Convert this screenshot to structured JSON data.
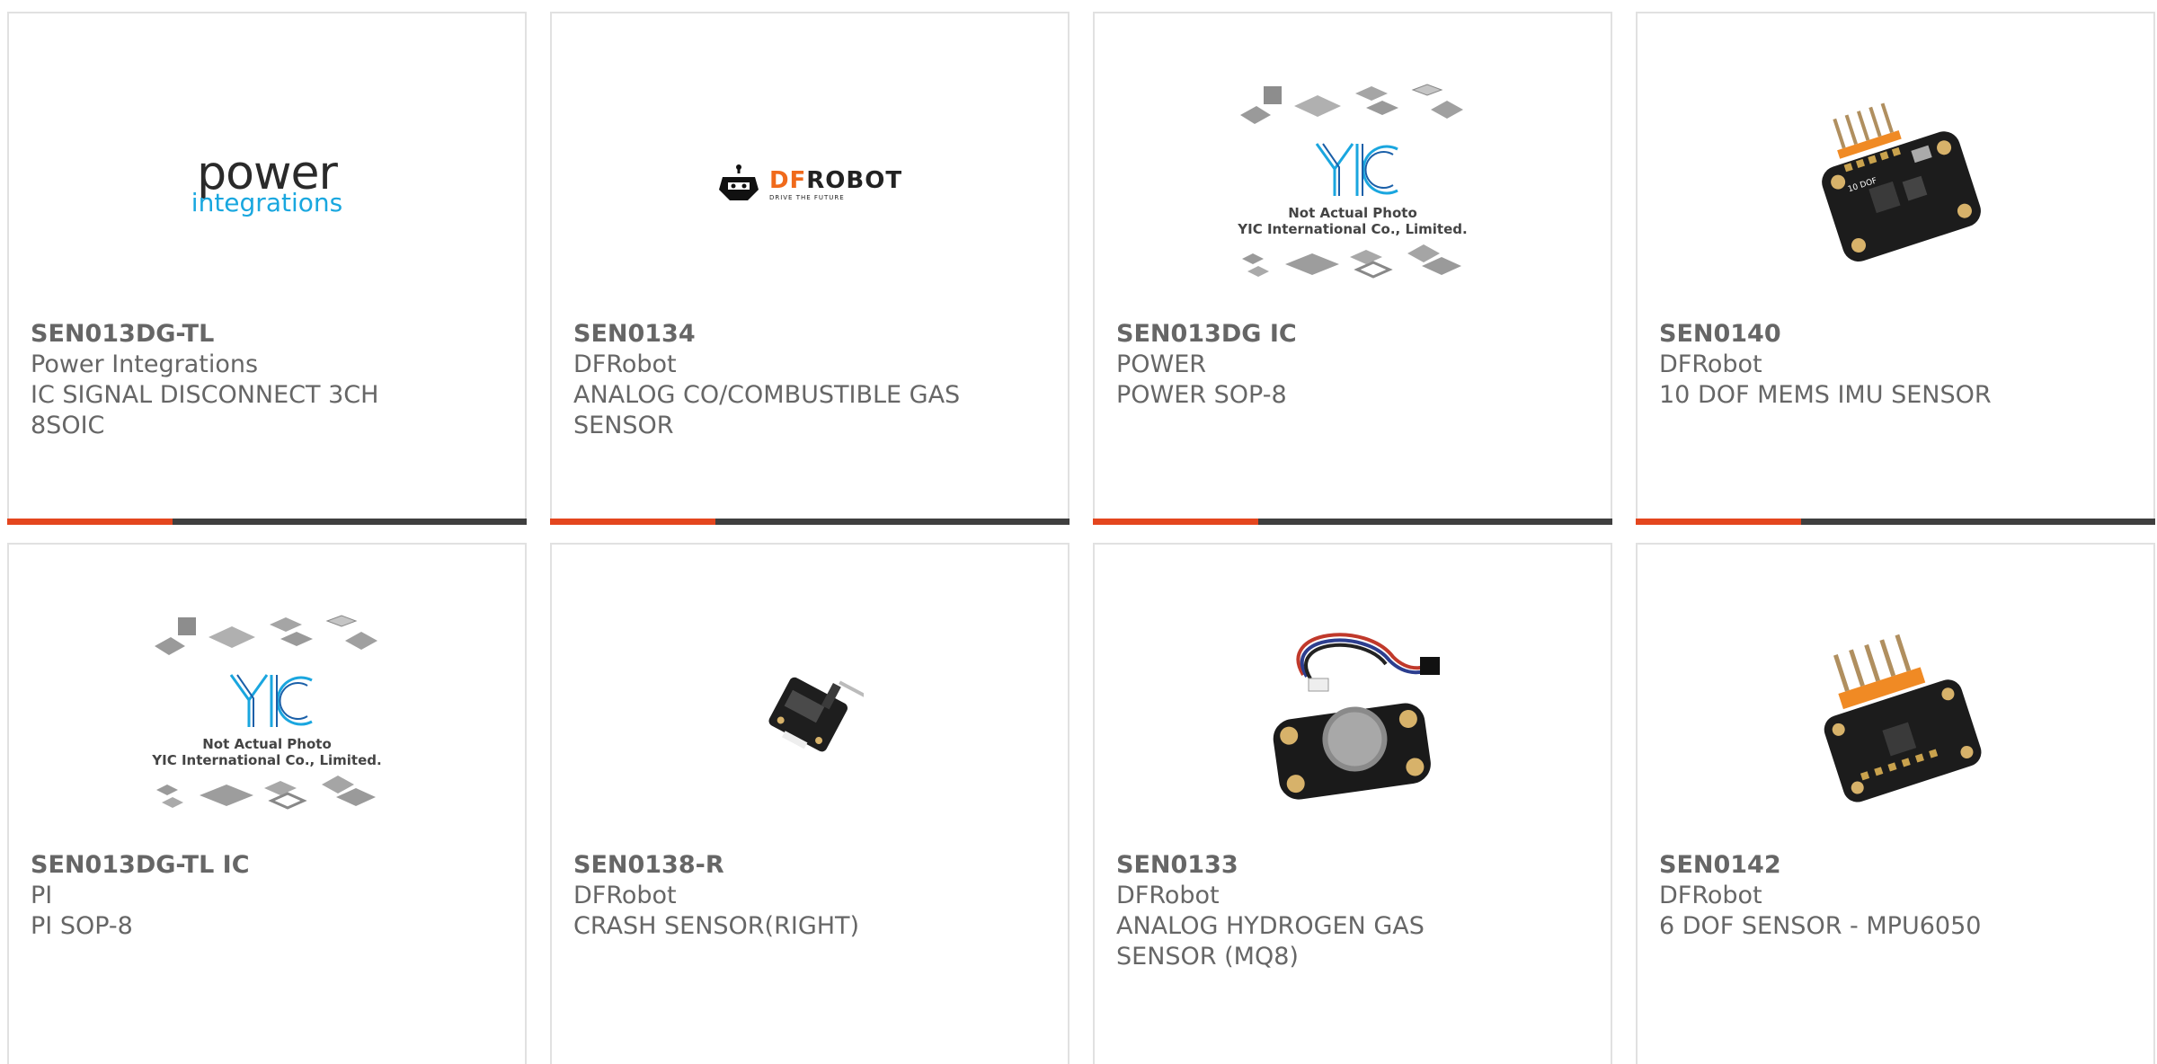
{
  "products": [
    {
      "part": "SEN013DG-TL",
      "manufacturer": "Power Integrations",
      "description": "IC SIGNAL DISCONNECT 3CH\n8SOIC",
      "image": "power-integrations-logo"
    },
    {
      "part": "SEN0134",
      "manufacturer": "DFRobot",
      "description": "ANALOG CO/COMBUSTIBLE GAS\nSENSOR",
      "image": "dfrobot-logo"
    },
    {
      "part": "SEN013DG IC",
      "manufacturer": "POWER",
      "description": "POWER SOP-8",
      "image": "yic-placeholder"
    },
    {
      "part": "SEN0140",
      "manufacturer": "DFRobot",
      "description": "10 DOF MEMS IMU SENSOR",
      "image": "imu-board-photo"
    },
    {
      "part": "SEN013DG-TL IC",
      "manufacturer": "PI",
      "description": "PI SOP-8",
      "image": "yic-placeholder"
    },
    {
      "part": "SEN0138-R",
      "manufacturer": "DFRobot",
      "description": "CRASH SENSOR(RIGHT)",
      "image": "crash-sensor-photo"
    },
    {
      "part": "SEN0133",
      "manufacturer": "DFRobot",
      "description": "ANALOG HYDROGEN GAS\nSENSOR (MQ8)",
      "image": "gas-sensor-photo"
    },
    {
      "part": "SEN0142",
      "manufacturer": "DFRobot",
      "description": "6 DOF SENSOR - MPU6050",
      "image": "mpu6050-board-photo"
    }
  ],
  "logos": {
    "power_word": "power",
    "integrations_word": "integrations",
    "dfrobot_df": "DF",
    "dfrobot_robot": "ROBOT",
    "dfrobot_tagline": "DRIVE THE FUTURE",
    "yic_line1": "Not Actual Photo",
    "yic_line2": "YIC International Co., Limited.",
    "imu_label": "10 DOF"
  },
  "colors": {
    "accent": "#e4461e",
    "bar": "#3f3f3f",
    "border": "#e1e1e1",
    "text": "#666666"
  }
}
